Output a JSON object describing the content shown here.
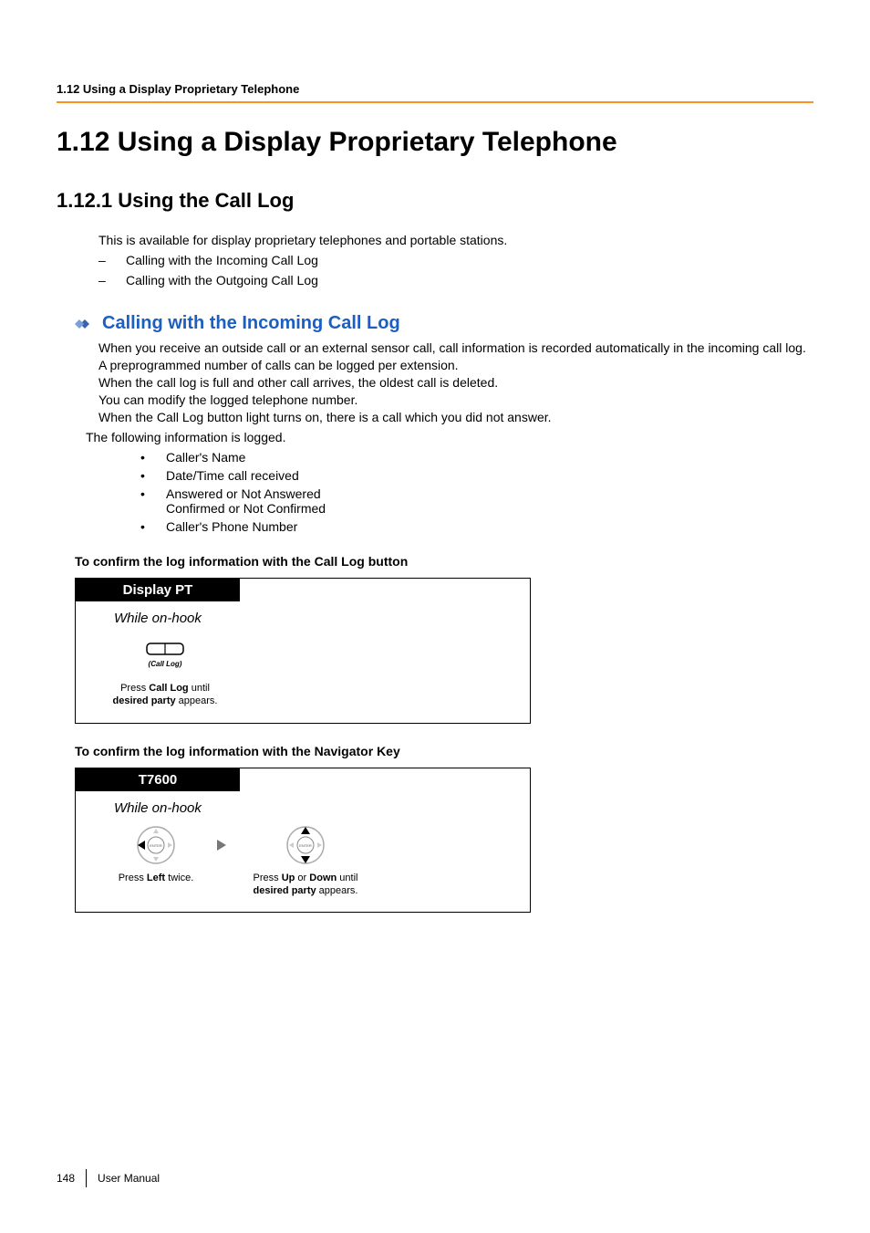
{
  "runningHead": "1.12 Using a Display Proprietary Telephone",
  "h1": "1.12   Using a Display Proprietary Telephone",
  "h2": "1.12.1  Using the Call Log",
  "intro": "This is available for display proprietary telephones and portable stations.",
  "dashItems": [
    "Calling with the Incoming Call Log",
    "Calling with the Outgoing Call Log"
  ],
  "subHead": "Calling with the Incoming Call Log",
  "paraLines": [
    "When you receive an outside call or an external sensor call, call information is recorded automatically in the incoming call log. A preprogrammed number of calls can be logged per extension.",
    "When the call log is full and other call arrives, the oldest call is deleted.",
    "You can modify the logged telephone number.",
    "When the Call Log button light turns on, there is a call which you did not answer."
  ],
  "followingLine": "The following information is logged.",
  "bullets": [
    {
      "lines": [
        "Caller's Name"
      ]
    },
    {
      "lines": [
        "Date/Time call received"
      ]
    },
    {
      "lines": [
        "Answered or Not Answered",
        "Confirmed or Not Confirmed"
      ]
    },
    {
      "lines": [
        "Caller's Phone Number"
      ]
    }
  ],
  "confirm1": "To confirm the log information with the Call Log button",
  "diagram1": {
    "header": "Display PT",
    "sub": "While on-hook",
    "iconLabel": "(Call Log)",
    "caption_pre": "Press ",
    "caption_b1": "Call Log",
    "caption_mid": " until",
    "caption_b2": "desired party",
    "caption_post": " appears."
  },
  "confirm2": "To confirm the log information with the Navigator Key",
  "diagram2": {
    "header": "T7600",
    "sub": "While on-hook",
    "step1_pre": "Press ",
    "step1_b": "Left",
    "step1_post": " twice.",
    "step2_pre": "Press ",
    "step2_b1": "Up",
    "step2_mid1": " or ",
    "step2_b2": "Down",
    "step2_mid2": " until",
    "step2_b3": "desired party",
    "step2_post": " appears."
  },
  "footer": {
    "page": "148",
    "label": "User Manual"
  }
}
